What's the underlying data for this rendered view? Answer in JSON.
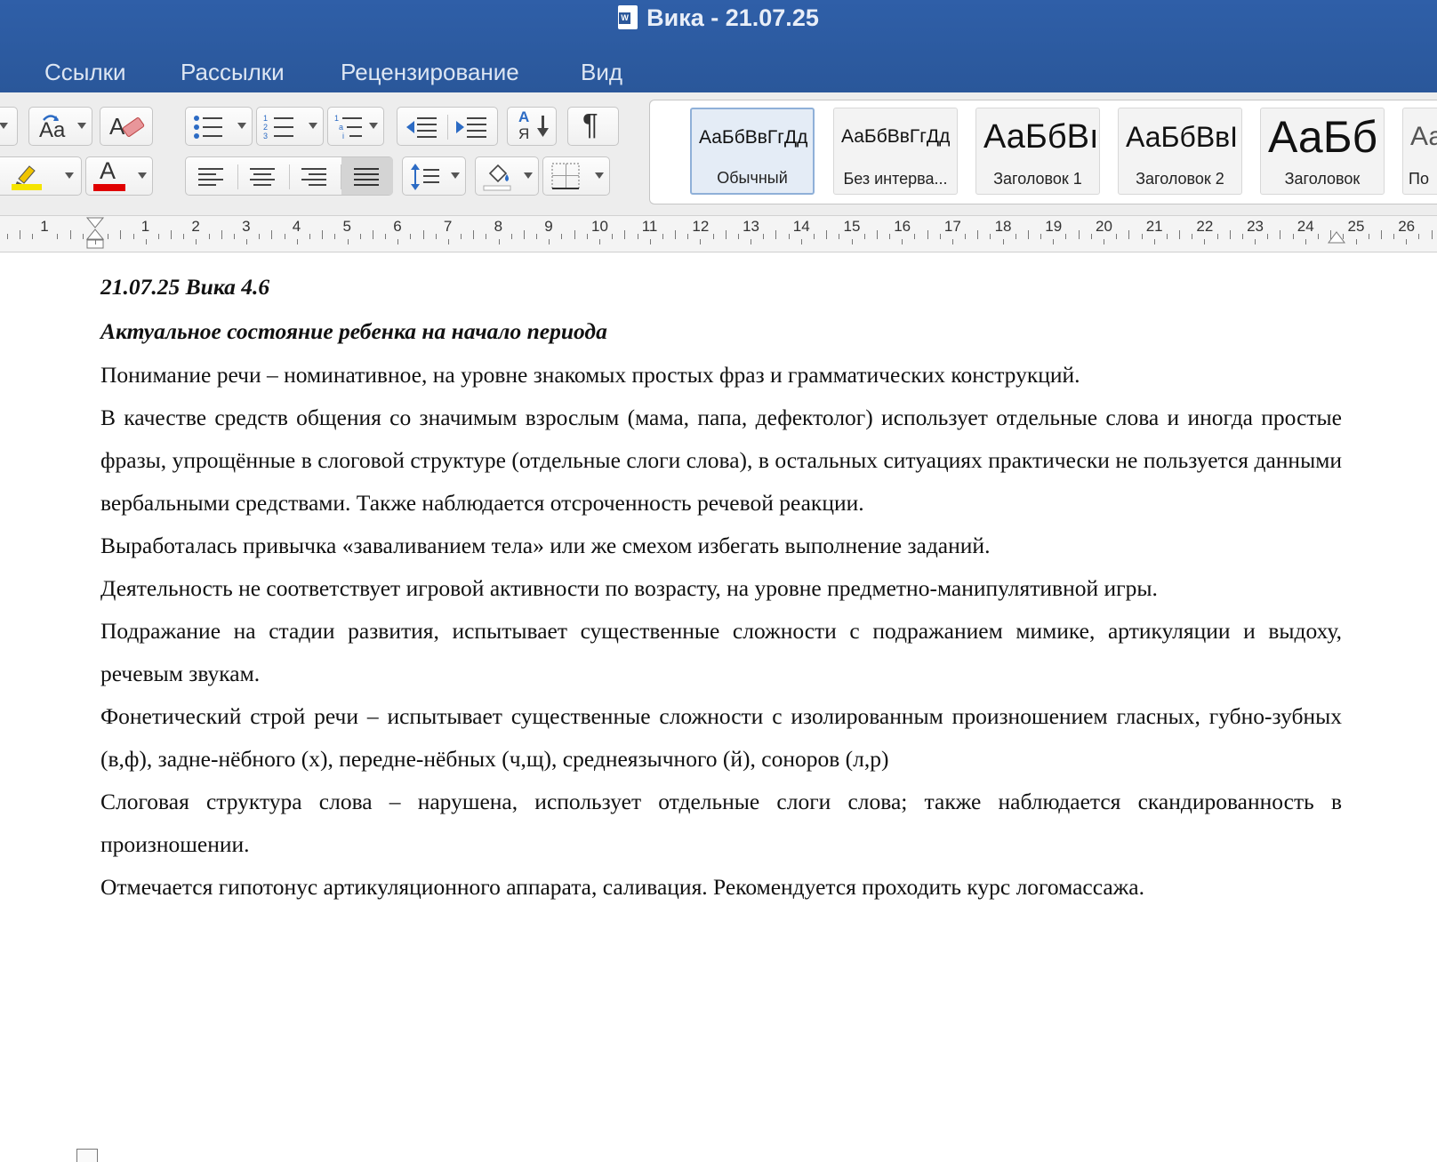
{
  "window": {
    "title": "Вика - 21.07.25"
  },
  "ribbon_tabs": [
    "Ссылки",
    "Рассылки",
    "Рецензирование",
    "Вид"
  ],
  "styles_gallery": [
    {
      "sample": "АаБбВвГгДд",
      "name": "Обычный",
      "selected": true
    },
    {
      "sample": "АаБбВвГгДд",
      "name": "Без интерва..."
    },
    {
      "sample": "АаБбВı",
      "name": "Заголовок 1"
    },
    {
      "sample": "АаБбВвI",
      "name": "Заголовок 2"
    },
    {
      "sample": "АаБб",
      "name": "Заголовок"
    },
    {
      "sample": "Аа",
      "name": "По"
    }
  ],
  "toolbar": {
    "change_case_label": "Aa",
    "font_color": "#e00000",
    "highlight_color": "#f5e400",
    "sort_label_top": "А",
    "sort_label_bottom": "Я",
    "show_marks_label": "¶",
    "font_color_label": "A"
  },
  "ruler": {
    "numbers": [
      "1",
      "1",
      "2",
      "3",
      "4",
      "5",
      "6",
      "7",
      "8",
      "9",
      "10",
      "11",
      "12",
      "13",
      "14",
      "15",
      "16",
      "17",
      "18",
      "19",
      "20",
      "21",
      "22",
      "23",
      "24",
      "25",
      "26"
    ]
  },
  "document": {
    "heading1": "21.07.25 Вика 4.6",
    "heading2": "Актуальное состояние ребенка на начало периода",
    "paragraphs": [
      "Понимание речи – номинативное, на уровне знакомых простых фраз и грамматических конструкций.",
      "В качестве средств общения со значимым взрослым (мама, папа, дефектолог) использует отдельные слова и иногда простые фразы, упрощённые в слоговой структуре (отдельные слоги слова), в остальных ситуациях практически не пользуется  данными вербальными средствами. Также наблюдается отсроченность речевой реакции.",
      "Выработалась привычка «заваливанием тела» или же смехом избегать выполнение заданий.",
      "Деятельность не соответствует игровой активности по возрасту, на уровне предметно-манипулятивной игры.",
      "Подражание на стадии развития, испытывает существенные сложности с подражанием мимике, артикуляции и выдоху, речевым звукам.",
      "Фонетический строй речи – испытывает существенные сложности с изолированным произношением гласных, губно-зубных (в,ф), задне-нёбного (х), передне-нёбных (ч,щ), среднеязычного (й), соноров (л,р)",
      "Слоговая структура слова – нарушена, использует отдельные слоги слова; также наблюдается скандированность в произношении.",
      "Отмечается гипотонус артикуляционного аппарата, саливация. Рекомендуется проходить курс логомассажа."
    ]
  }
}
